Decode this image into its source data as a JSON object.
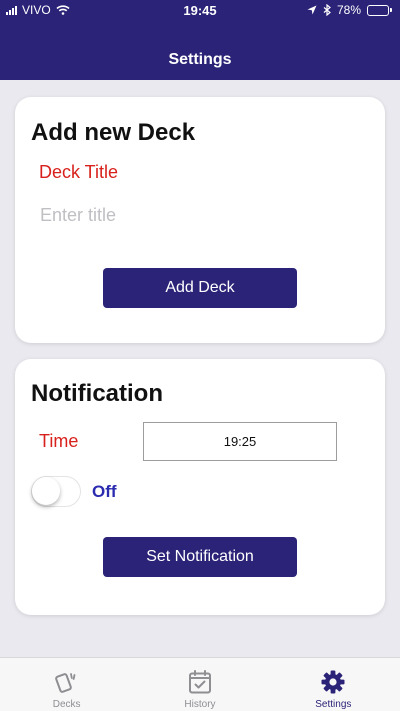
{
  "status_bar": {
    "carrier": "VIVO",
    "time": "19:45",
    "battery_text": "78%",
    "battery_level": 0.78
  },
  "header": {
    "title": "Settings"
  },
  "add_deck": {
    "title": "Add new Deck",
    "field_label": "Deck Title",
    "input_value": "",
    "input_placeholder": "Enter title",
    "button_label": "Add Deck"
  },
  "notification": {
    "title": "Notification",
    "time_label": "Time",
    "time_value": "19:25",
    "toggle_on": false,
    "toggle_label": "Off",
    "button_label": "Set Notification"
  },
  "tabs": [
    {
      "label": "Decks",
      "icon": "cards-icon",
      "active": false
    },
    {
      "label": "History",
      "icon": "calendar-check-icon",
      "active": false
    },
    {
      "label": "Settings",
      "icon": "gear-icon",
      "active": true
    }
  ],
  "colors": {
    "primary": "#2b2377",
    "label_red": "#d8201c",
    "toggle_label": "#2b2bb0",
    "background": "#e9e9ef",
    "tab_inactive": "#8e8e93"
  }
}
